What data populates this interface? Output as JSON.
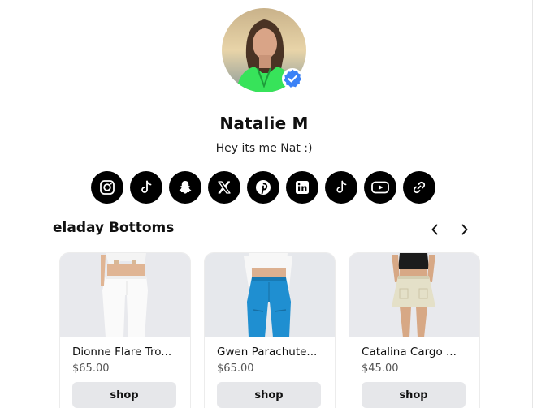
{
  "profile": {
    "name": "Natalie M",
    "bio": "Hey its me Nat :)",
    "verified": true
  },
  "social_links": [
    {
      "icon": "instagram-icon"
    },
    {
      "icon": "tiktok-icon"
    },
    {
      "icon": "snapchat-icon"
    },
    {
      "icon": "x-icon"
    },
    {
      "icon": "pinterest-icon"
    },
    {
      "icon": "linkedin-icon"
    },
    {
      "icon": "tiktok-alt-icon"
    },
    {
      "icon": "youtube-icon"
    },
    {
      "icon": "link-icon"
    }
  ],
  "section": {
    "title": "eladay Bottoms"
  },
  "products": [
    {
      "title": "Dionne Flare Tro...",
      "price": "$65.00",
      "button": "shop"
    },
    {
      "title": "Gwen Parachute...",
      "price": "$65.00",
      "button": "shop"
    },
    {
      "title": "Catalina Cargo ...",
      "price": "$45.00",
      "button": "shop"
    }
  ],
  "colors": {
    "social_bg": "#000000",
    "verified_badge": "#3b82f6",
    "shop_button_bg": "#e6e7ea"
  }
}
